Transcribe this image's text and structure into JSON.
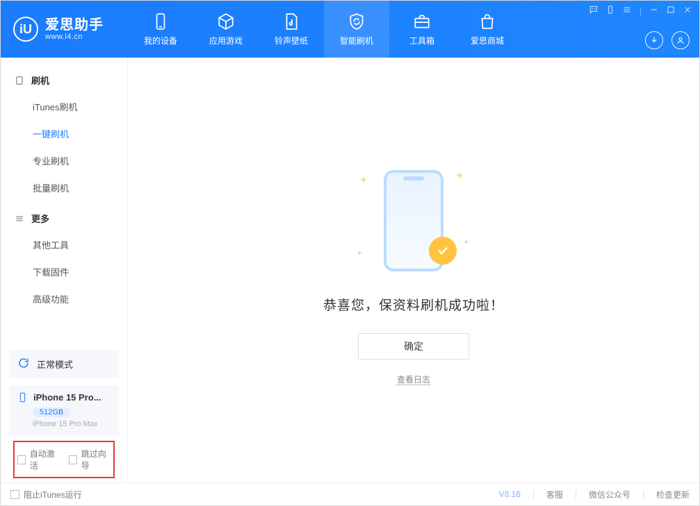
{
  "brand": {
    "title": "爱思助手",
    "subtitle": "www.i4.cn",
    "logo_letter": "iU"
  },
  "nav": [
    {
      "label": "我的设备",
      "icon": "device"
    },
    {
      "label": "应用游戏",
      "icon": "cube"
    },
    {
      "label": "铃声壁纸",
      "icon": "music"
    },
    {
      "label": "智能刷机",
      "icon": "refresh",
      "active": true
    },
    {
      "label": "工具箱",
      "icon": "toolbox"
    },
    {
      "label": "爱思商城",
      "icon": "bag"
    }
  ],
  "sidebar": {
    "groups": [
      {
        "title": "刷机",
        "icon": "tablet",
        "items": [
          "iTunes刷机",
          "一键刷机",
          "专业刷机",
          "批量刷机"
        ],
        "activeIndex": 1
      },
      {
        "title": "更多",
        "icon": "menu",
        "items": [
          "其他工具",
          "下载固件",
          "高级功能"
        ],
        "activeIndex": -1
      }
    ],
    "status": {
      "label": "正常模式"
    },
    "device": {
      "name": "iPhone 15 Pro...",
      "storage": "512GB",
      "model": "iPhone 15 Pro Max"
    },
    "checkboxes": {
      "auto_activate": "自动激活",
      "skip_wizard": "跳过向导"
    }
  },
  "main": {
    "headline": "恭喜您，保资料刷机成功啦！",
    "ok_button": "确定",
    "log_link": "查看日志"
  },
  "footer": {
    "block_itunes": "阻止iTunes运行",
    "version": "V8.16",
    "links": [
      "客服",
      "微信公众号",
      "检查更新"
    ]
  }
}
